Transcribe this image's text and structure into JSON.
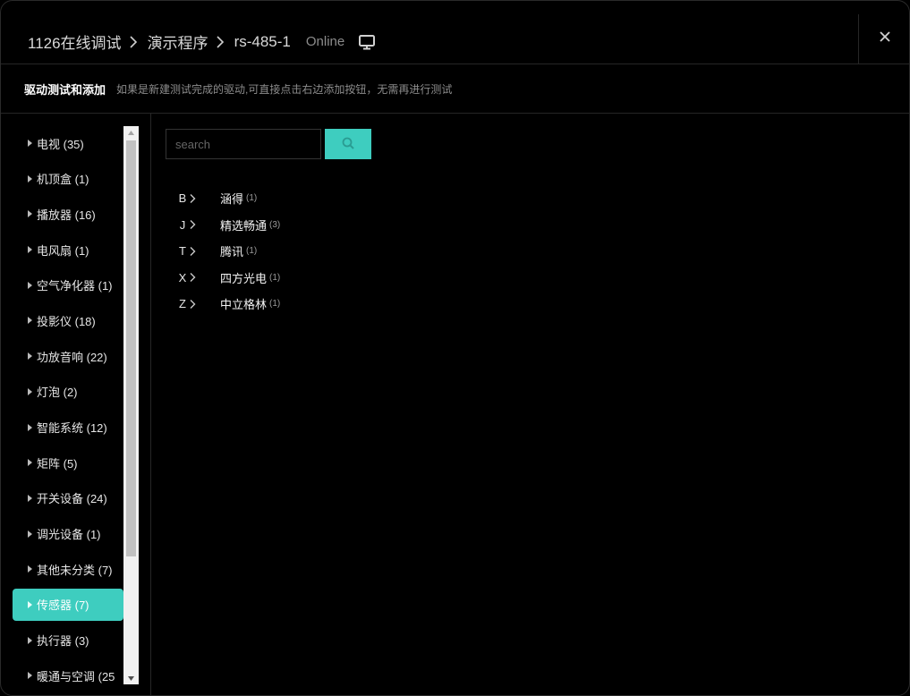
{
  "breadcrumb": {
    "items": [
      "1126在线调试",
      "演示程序",
      "rs-485-1"
    ],
    "status": "Online"
  },
  "subheader": {
    "title": "驱动测试和添加",
    "hint": "如果是新建测试完成的驱动,可直接点击右边添加按钮，无需再进行测试"
  },
  "sidebar": {
    "categories": [
      {
        "label": "电视 (35)"
      },
      {
        "label": "机顶盒 (1)"
      },
      {
        "label": "播放器 (16)"
      },
      {
        "label": "电风扇 (1)"
      },
      {
        "label": "空气净化器 (1)"
      },
      {
        "label": "投影仪 (18)"
      },
      {
        "label": "功放音响 (22)"
      },
      {
        "label": "灯泡 (2)"
      },
      {
        "label": "智能系统 (12)"
      },
      {
        "label": "矩阵 (5)"
      },
      {
        "label": "开关设备 (24)"
      },
      {
        "label": "调光设备 (1)"
      },
      {
        "label": "其他未分类 (7)"
      },
      {
        "label": "传感器 (7)"
      },
      {
        "label": "执行器 (3)"
      },
      {
        "label": "暖通与空调 (25"
      }
    ],
    "active_index": 13
  },
  "search": {
    "placeholder": "search",
    "value": ""
  },
  "brand_groups": [
    {
      "letter": "B",
      "brand": "涵得",
      "count": "(1)"
    },
    {
      "letter": "J",
      "brand": "精选畅通",
      "count": "(3)"
    },
    {
      "letter": "T",
      "brand": "腾讯",
      "count": "(1)"
    },
    {
      "letter": "X",
      "brand": "四方光电",
      "count": "(1)"
    },
    {
      "letter": "Z",
      "brand": "中立格林",
      "count": "(1)"
    }
  ],
  "colors": {
    "accent": "#3ecdbf",
    "background": "#000000"
  },
  "icons": {
    "monitor": "monitor-icon",
    "close": "close-icon",
    "search": "search-icon",
    "breadcrumb_separator": "chevron-right-icon",
    "category_caret": "caret-right-icon"
  }
}
